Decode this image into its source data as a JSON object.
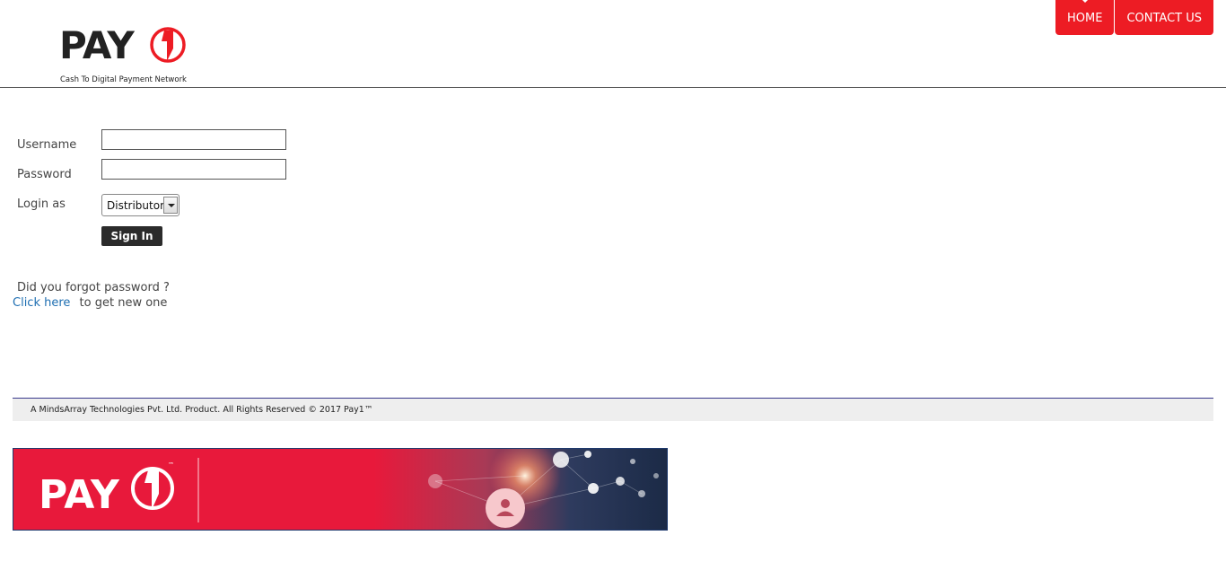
{
  "header": {
    "logo": {
      "word": "PAY",
      "tagline": "Cash To Digital Payment Network",
      "brand_color": "#ed1c24"
    },
    "nav": [
      {
        "label": "HOME"
      },
      {
        "label": "CONTACT US"
      }
    ]
  },
  "login_form": {
    "username_label": "Username",
    "username_value": "",
    "password_label": "Password",
    "password_value": "",
    "login_as_label": "Login as",
    "login_as_selected": "Distributor",
    "signin_label": "Sign In"
  },
  "forgot": {
    "question": "Did you forgot password ?",
    "link_text": "Click here",
    "suffix": "to get new one"
  },
  "footer": {
    "text": "A MindsArray Technologies Pvt. Ltd. Product. All Rights Reserved © 2017 Pay1™"
  },
  "banner": {
    "brand": "PAY",
    "trademark": "™",
    "color": "#e8193b"
  }
}
